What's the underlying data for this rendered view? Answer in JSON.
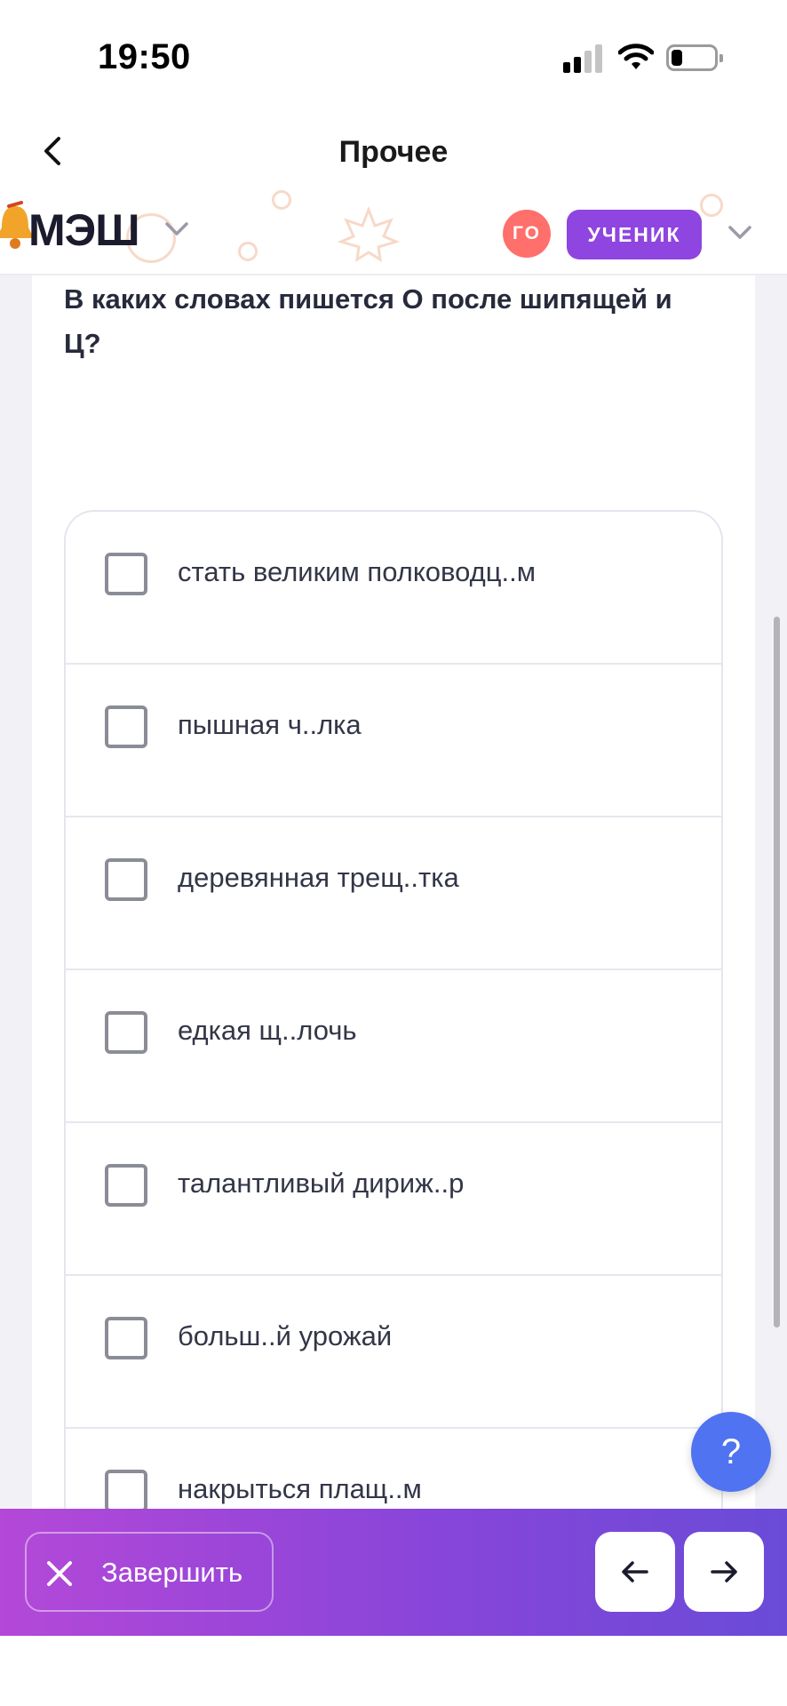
{
  "status_bar": {
    "time": "19:50"
  },
  "nav": {
    "title": "Прочее"
  },
  "app_header": {
    "logo": "МЭШ",
    "avatar_initials": "ГО",
    "role": "УЧЕНИК"
  },
  "question": {
    "text": "В каких словах пишется О после шипящей и Ц?"
  },
  "options": [
    {
      "text": "стать великим полководц..м",
      "checked": false
    },
    {
      "text": "пышная ч..лка",
      "checked": false
    },
    {
      "text": "деревянная трещ..тка",
      "checked": false
    },
    {
      "text": "едкая щ..лочь",
      "checked": false
    },
    {
      "text": "талантливый дириж..р",
      "checked": false
    },
    {
      "text": "больш..й урожай",
      "checked": false
    },
    {
      "text": "накрыться плащ..м",
      "checked": false
    }
  ],
  "help_button": {
    "label": "?"
  },
  "bottom_bar": {
    "finish_label": "Завершить"
  },
  "colors": {
    "accent_purple": "#8f45e0",
    "avatar_red": "#ff6f6b",
    "help_blue": "#4f73f1",
    "bar_gradient_start": "#b448d8",
    "bar_gradient_end": "#6a4bd8"
  }
}
